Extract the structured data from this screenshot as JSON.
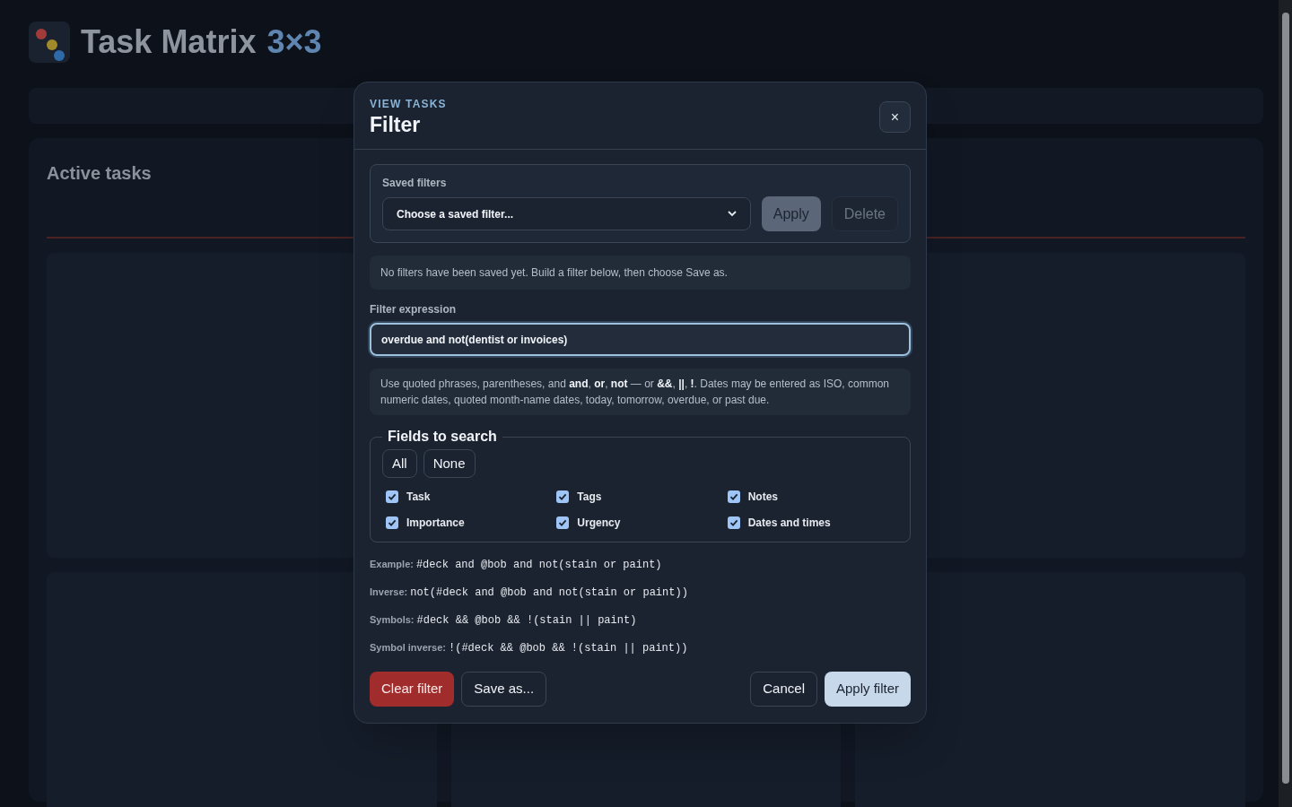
{
  "background": {
    "app_title": "Task Matrix",
    "app_badge": "3×3",
    "section_title": "Active tasks"
  },
  "dialog": {
    "eyebrow": "VIEW TASKS",
    "title": "Filter",
    "close": "×",
    "saved_filters": {
      "label": "Saved filters",
      "select_value": "Choose a saved filter...",
      "apply": "Apply",
      "delete": "Delete",
      "note": "No filters have been saved yet. Build a filter below, then choose Save as."
    },
    "expression": {
      "label": "Filter expression",
      "value": "overdue and not(dentist or invoices)",
      "focused": true
    },
    "help": "Use quoted phrases, parentheses, and **and**, **or**, **not** — or **&&**, **||**, **!**. Dates may be entered as ISO, common numeric dates, quoted month-name dates, today, tomorrow, overdue, or past due.",
    "fields": {
      "legend": "Fields to search",
      "all": "All",
      "none": "None",
      "options": [
        {
          "label": "Task",
          "checked": true
        },
        {
          "label": "Tags",
          "checked": true
        },
        {
          "label": "Notes",
          "checked": true
        },
        {
          "label": "Importance",
          "checked": true
        },
        {
          "label": "Urgency",
          "checked": true
        },
        {
          "label": "Dates and times",
          "checked": true
        }
      ]
    },
    "examples": [
      {
        "label": "Example:",
        "code": "#deck and @bob and not(stain or paint)"
      },
      {
        "label": "Inverse:",
        "code": "not(#deck and @bob and not(stain or paint))"
      },
      {
        "label": "Symbols:",
        "code": "#deck && @bob && !(stain || paint)"
      },
      {
        "label": "Symbol inverse:",
        "code": "!(#deck && @bob && !(stain || paint))"
      }
    ],
    "buttons": {
      "clear": "Clear filter",
      "save_as": "Save as...",
      "cancel": "Cancel",
      "apply": "Apply filter"
    }
  }
}
